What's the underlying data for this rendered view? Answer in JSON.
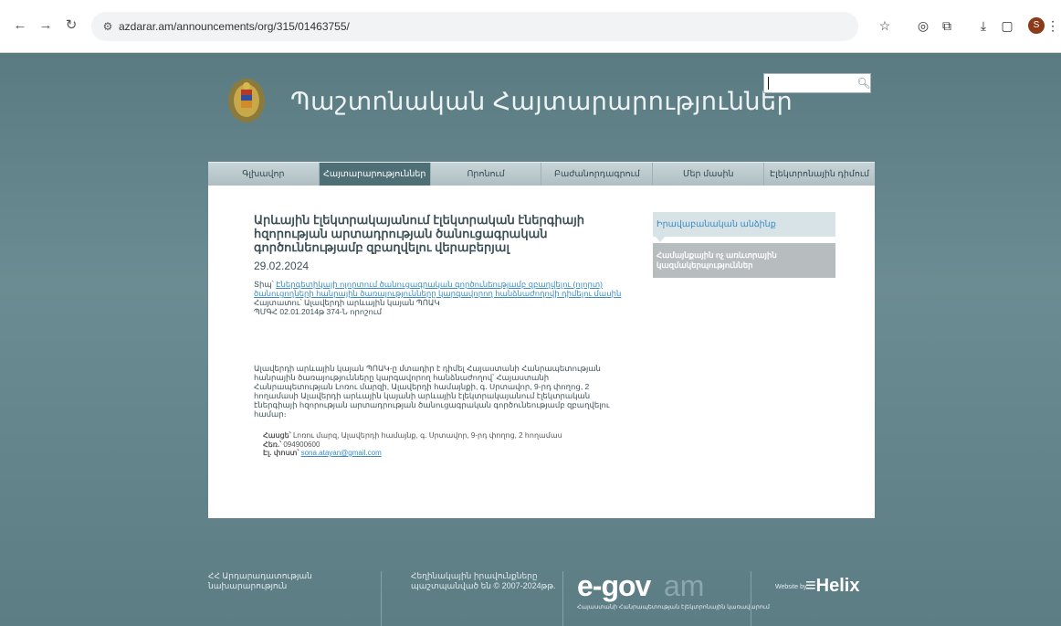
{
  "browser": {
    "url": "azdarar.am/announcements/org/315/01463755/",
    "profile_initial": "S"
  },
  "header": {
    "site_title": "Պաշտոնական Հայտարարություններ",
    "search_placeholder": ""
  },
  "nav": {
    "items": [
      {
        "label": "Գլխավոր"
      },
      {
        "label": "Հայտարարություններ"
      },
      {
        "label": "Որոնում"
      },
      {
        "label": "Բաժանորդագրում"
      },
      {
        "label": "Մեր մասին"
      },
      {
        "label": "Էլեկտրոնային դիմում"
      }
    ]
  },
  "article": {
    "title": "Արևային էլեկտրակայանում էլեկտրական էներգիայի հզորության արտադրության ծանուցագրական գործունեությամբ զբաղվելու վերաբերյալ",
    "date": "29.02.2024",
    "type_label": "Տիպ՝",
    "type_link": "Էներգետիկայի ոլորտում ծանուցագրական գործունեությամբ զբաղվելու (ոլորտ) ծանուցողների հանրային ծառայությունները կարգավորող հանձնաժողովի դիմելու մասին",
    "announcer": "Հայտատու՝ Ալավերդի արևային կայան ՊՈԱԿ",
    "registration": "ՊՄԳՀ 02.01.2014թ 374-Ն որոշում",
    "body": "Ալավերդի արևային կայան ՊՈԱԿ-ը մտադիր է դիմել Հայաստանի Հանրապետության հանրային ծառայությունները կարգավորող հանձնաժողով՝ Հայաստանի Հանրապետության Լոռու մարզի, Ալավերդի համայնքի, գ. Սրտավոր, 9-րդ փողոց, 2 հողամասի Ալավերդի արևային կայանի արևային էլեկտրակայանում էլեկտրական էներգիայի հզորության արտադրության ծանուցագրական գործունեությամբ զբաղվելու համար։",
    "address_label": "Հասցե՝",
    "address": "Լոռու մարզ, Ալավերդի համայնք, գ. Սրտավոր, 9-րդ փողոց, 2 հողամաս",
    "phone_label": "Հեռ.՝",
    "phone": "094900600",
    "email_label": "Էլ. փոստ՝",
    "email": "sona.atayan@gmail.com"
  },
  "sidebar": {
    "primary": "Իրավաբանական անձինք",
    "secondary": "Համայնքային ոչ առևտրային կազմակերպություններ"
  },
  "footer": {
    "col1": "ՀՀ Արդարադատության նախարարություն",
    "col2": "Հեղինակային իրավունքները պաշտպանված են © 2007-2024թթ.",
    "egov_main": "e-gov",
    "egov_suffix": "am",
    "egov_sub": "Հայաստանի Հանրապետության էլեկտրոնային կառավարում",
    "helix_prefix": "Website by",
    "helix_logo": "≡Helix"
  },
  "colors": {
    "background": "#5d7e86",
    "nav_active": "#4f6f77",
    "link": "#3a8cc0"
  },
  "icons": [
    "back-arrow-icon",
    "forward-arrow-icon",
    "reload-icon",
    "site-info-icon",
    "star-icon",
    "extension-icon",
    "puzzle-icon",
    "download-icon",
    "sidepanel-icon",
    "menu-icon",
    "search-icon",
    "emblem-icon"
  ]
}
